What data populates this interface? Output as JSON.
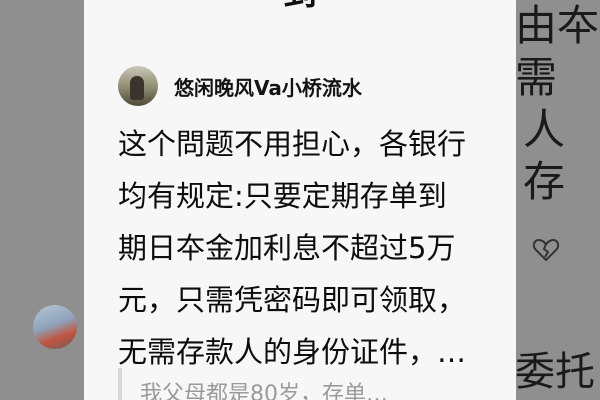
{
  "background": {
    "right_lines": [
      "由夲",
      "需",
      "人",
      "存"
    ],
    "right_bottom": "委托"
  },
  "card": {
    "top_title": "到",
    "author": {
      "name": "悠闲晚风Va小桥流水"
    },
    "content_lines": [
      "这个問题不用担心，各银行",
      "均有规定:只要定期存单到",
      "期日夲金加利息不超过5万",
      "元，只需凭密码即可领取，",
      "无需存款人的身份证件，…"
    ],
    "quote": "我父母都是80岁，存单…"
  },
  "icons": {
    "heart": "broken-heart-icon"
  }
}
